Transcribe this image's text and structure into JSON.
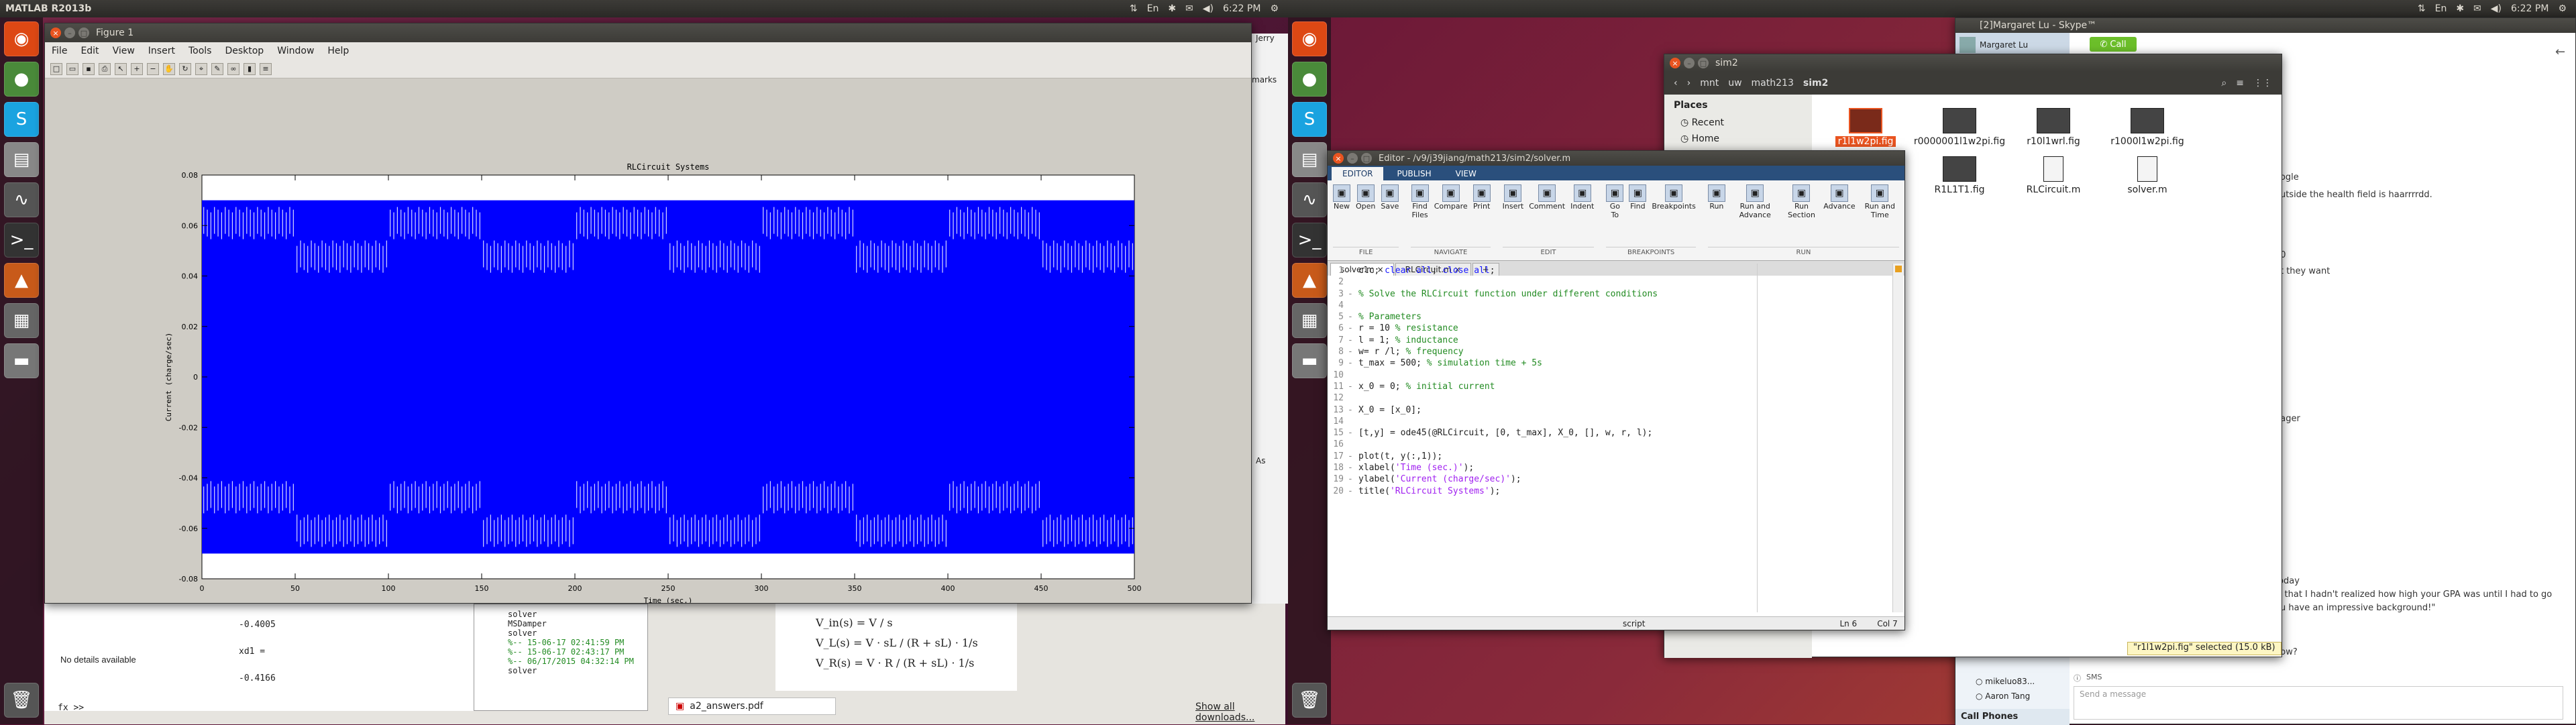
{
  "left_screen": {
    "panel_title": "MATLAB R2013b",
    "tray": [
      "⇅",
      "En",
      "✱",
      "✉",
      "◀)",
      "6:22 PM",
      "⚙"
    ]
  },
  "right_screen": {
    "tray": [
      "⇅",
      "En",
      "✱",
      "✉",
      "◀)",
      "6:22 PM",
      "⚙"
    ]
  },
  "figure": {
    "title": "Figure 1",
    "menu": [
      "File",
      "Edit",
      "View",
      "Insert",
      "Tools",
      "Desktop",
      "Window",
      "Help"
    ],
    "plot_title": "RLCircuit Systems",
    "xlabel": "Time (sec.)",
    "ylabel": "Current (charge/sec)",
    "xticks": [
      "0",
      "50",
      "100",
      "150",
      "200",
      "250",
      "300",
      "350",
      "400",
      "450",
      "500"
    ],
    "yticks": [
      "0.08",
      "0.06",
      "0.04",
      "0.02",
      "0",
      "-0.02",
      "-0.04",
      "-0.06",
      "-0.08"
    ],
    "series_color": "#0000ff"
  },
  "chart_data": {
    "type": "line",
    "title": "RLCircuit Systems",
    "xlabel": "Time (sec.)",
    "ylabel": "Current (charge/sec)",
    "xlim": [
      0,
      500
    ],
    "ylim": [
      -0.08,
      0.08
    ],
    "x": [
      0,
      500
    ],
    "envelope_upper": [
      0.07,
      0.07
    ],
    "envelope_lower": [
      -0.07,
      -0.07
    ],
    "grid": false
  },
  "matlab_bg": {
    "details": "No details available",
    "workspace_lines": [
      "-0.4005",
      "",
      "xd1 =",
      "",
      "-0.4166"
    ],
    "prompt": "fx >>",
    "history": [
      "solver",
      "MSDamper",
      "solver",
      "%-- 15-06-17 02:41:59 PM",
      "%-- 15-06-17 02:43:17 PM",
      "%-- 06/17/2015 04:32:14 PM",
      "solver"
    ],
    "equations": [
      "V_in(s) = V / s",
      "V_L(s) = V · sL / (R + sL) · 1/s",
      "V_R(s) = V · R / (R + sL) · 1/s"
    ],
    "download": "a2_answers.pdf",
    "show_downloads": "Show all downloads...",
    "browser_fragments": [
      "marks",
      "Jerry",
      "As"
    ]
  },
  "editor": {
    "title": "Editor - /v9/j39jiang/math213/sim2/solver.m",
    "ribbon_tabs": [
      "EDITOR",
      "PUBLISH",
      "VIEW"
    ],
    "groups": [
      {
        "name": "FILE",
        "items": [
          "New",
          "Open",
          "Save"
        ]
      },
      {
        "name": "NAVIGATE",
        "items": [
          "Find Files",
          "Compare",
          "Print"
        ]
      },
      {
        "name": "EDIT",
        "items": [
          "Insert",
          "Comment",
          "Indent"
        ]
      },
      {
        "name": "BREAKPOINTS",
        "items": [
          "Go To",
          "Find",
          "Breakpoints"
        ]
      },
      {
        "name": "RUN",
        "items": [
          "Run",
          "Run and Advance",
          "Run Section",
          "Advance",
          "Run and Time"
        ]
      }
    ],
    "tabs": [
      "solver.m",
      "RLCircuit.m"
    ],
    "code": [
      {
        "n": "1",
        "parts": [
          [
            "",
            "clc; "
          ],
          [
            "kw",
            "clear all"
          ],
          [
            "",
            "; "
          ],
          [
            "kw",
            "close all"
          ],
          [
            "",
            ";"
          ]
        ]
      },
      {
        "n": "2",
        "parts": []
      },
      {
        "n": "3",
        "parts": [
          [
            "cm",
            "% Solve the RLCircuit function under different conditions"
          ]
        ]
      },
      {
        "n": "4",
        "parts": []
      },
      {
        "n": "5",
        "parts": [
          [
            "cm",
            "% Parameters"
          ]
        ]
      },
      {
        "n": "6",
        "parts": [
          [
            "",
            "r = 10 "
          ],
          [
            "cm",
            "% resistance"
          ]
        ]
      },
      {
        "n": "7",
        "parts": [
          [
            "",
            "l = 1; "
          ],
          [
            "cm",
            "% inductance"
          ]
        ]
      },
      {
        "n": "8",
        "parts": [
          [
            "",
            "w= r /l; "
          ],
          [
            "cm",
            "% frequency"
          ]
        ]
      },
      {
        "n": "9",
        "parts": [
          [
            "",
            "t_max = 500; "
          ],
          [
            "cm",
            "% simulation time + 5s"
          ]
        ]
      },
      {
        "n": "10",
        "parts": []
      },
      {
        "n": "11",
        "parts": [
          [
            "",
            "x_0 = 0; "
          ],
          [
            "cm",
            "% initial current"
          ]
        ]
      },
      {
        "n": "12",
        "parts": []
      },
      {
        "n": "13",
        "parts": [
          [
            "",
            "X_0 = [x_0];"
          ]
        ]
      },
      {
        "n": "14",
        "parts": []
      },
      {
        "n": "15",
        "parts": [
          [
            "",
            "[t,y] = ode45(@RLCircuit, [0, t_max], X_0, [], w, r, l);"
          ]
        ]
      },
      {
        "n": "16",
        "parts": []
      },
      {
        "n": "17",
        "parts": [
          [
            "",
            "plot(t, y(:,1));"
          ]
        ]
      },
      {
        "n": "18",
        "parts": [
          [
            "",
            "xlabel("
          ],
          [
            "st",
            "'Time (sec.)'"
          ],
          [
            "",
            ");"
          ]
        ]
      },
      {
        "n": "19",
        "parts": [
          [
            "",
            "ylabel("
          ],
          [
            "st",
            "'Current (charge/sec)'"
          ],
          [
            "",
            ");"
          ]
        ]
      },
      {
        "n": "20",
        "parts": [
          [
            "",
            "title("
          ],
          [
            "st",
            "'RLCircuit Systems'"
          ],
          [
            "",
            ");"
          ]
        ]
      }
    ],
    "status_script": "script",
    "status_ln": "Ln 6",
    "status_col": "Col 7"
  },
  "file_manager": {
    "title": "sim2",
    "breadcrumbs": [
      "mnt",
      "uw",
      "math213",
      "sim2"
    ],
    "sidebar_heading": "Places",
    "sidebar_items": [
      "Recent",
      "Home"
    ],
    "files": [
      "r1l1w2pi.fig",
      "r0000001l1w2pi.fig",
      "r10l1wrl.fig",
      "r1000l1w2pi.fig",
      "",
      "R1L1T1.fig",
      "RLCircuit.m",
      "solver.m"
    ],
    "status": "\"r1l1w2pi.fig\" selected (15.0 kB)"
  },
  "skype": {
    "title": "[2]Margaret Lu - Skype™",
    "contact": "Margaret Lu",
    "call_button": "Call",
    "chat_lines": [
      "oogle",
      "outside the health field is haarrrrdd.",
      "30",
      "at they want",
      "nager",
      "today",
      "is that I hadn't realized how high your GPA was until I had to go",
      "ou have an impressive background!\"",
      "how?"
    ],
    "contacts": [
      "mikeluo83...",
      "Aaron Tang"
    ],
    "call_phones": "Call Phones",
    "sms": "SMS",
    "message_placeholder": "Send a message"
  }
}
